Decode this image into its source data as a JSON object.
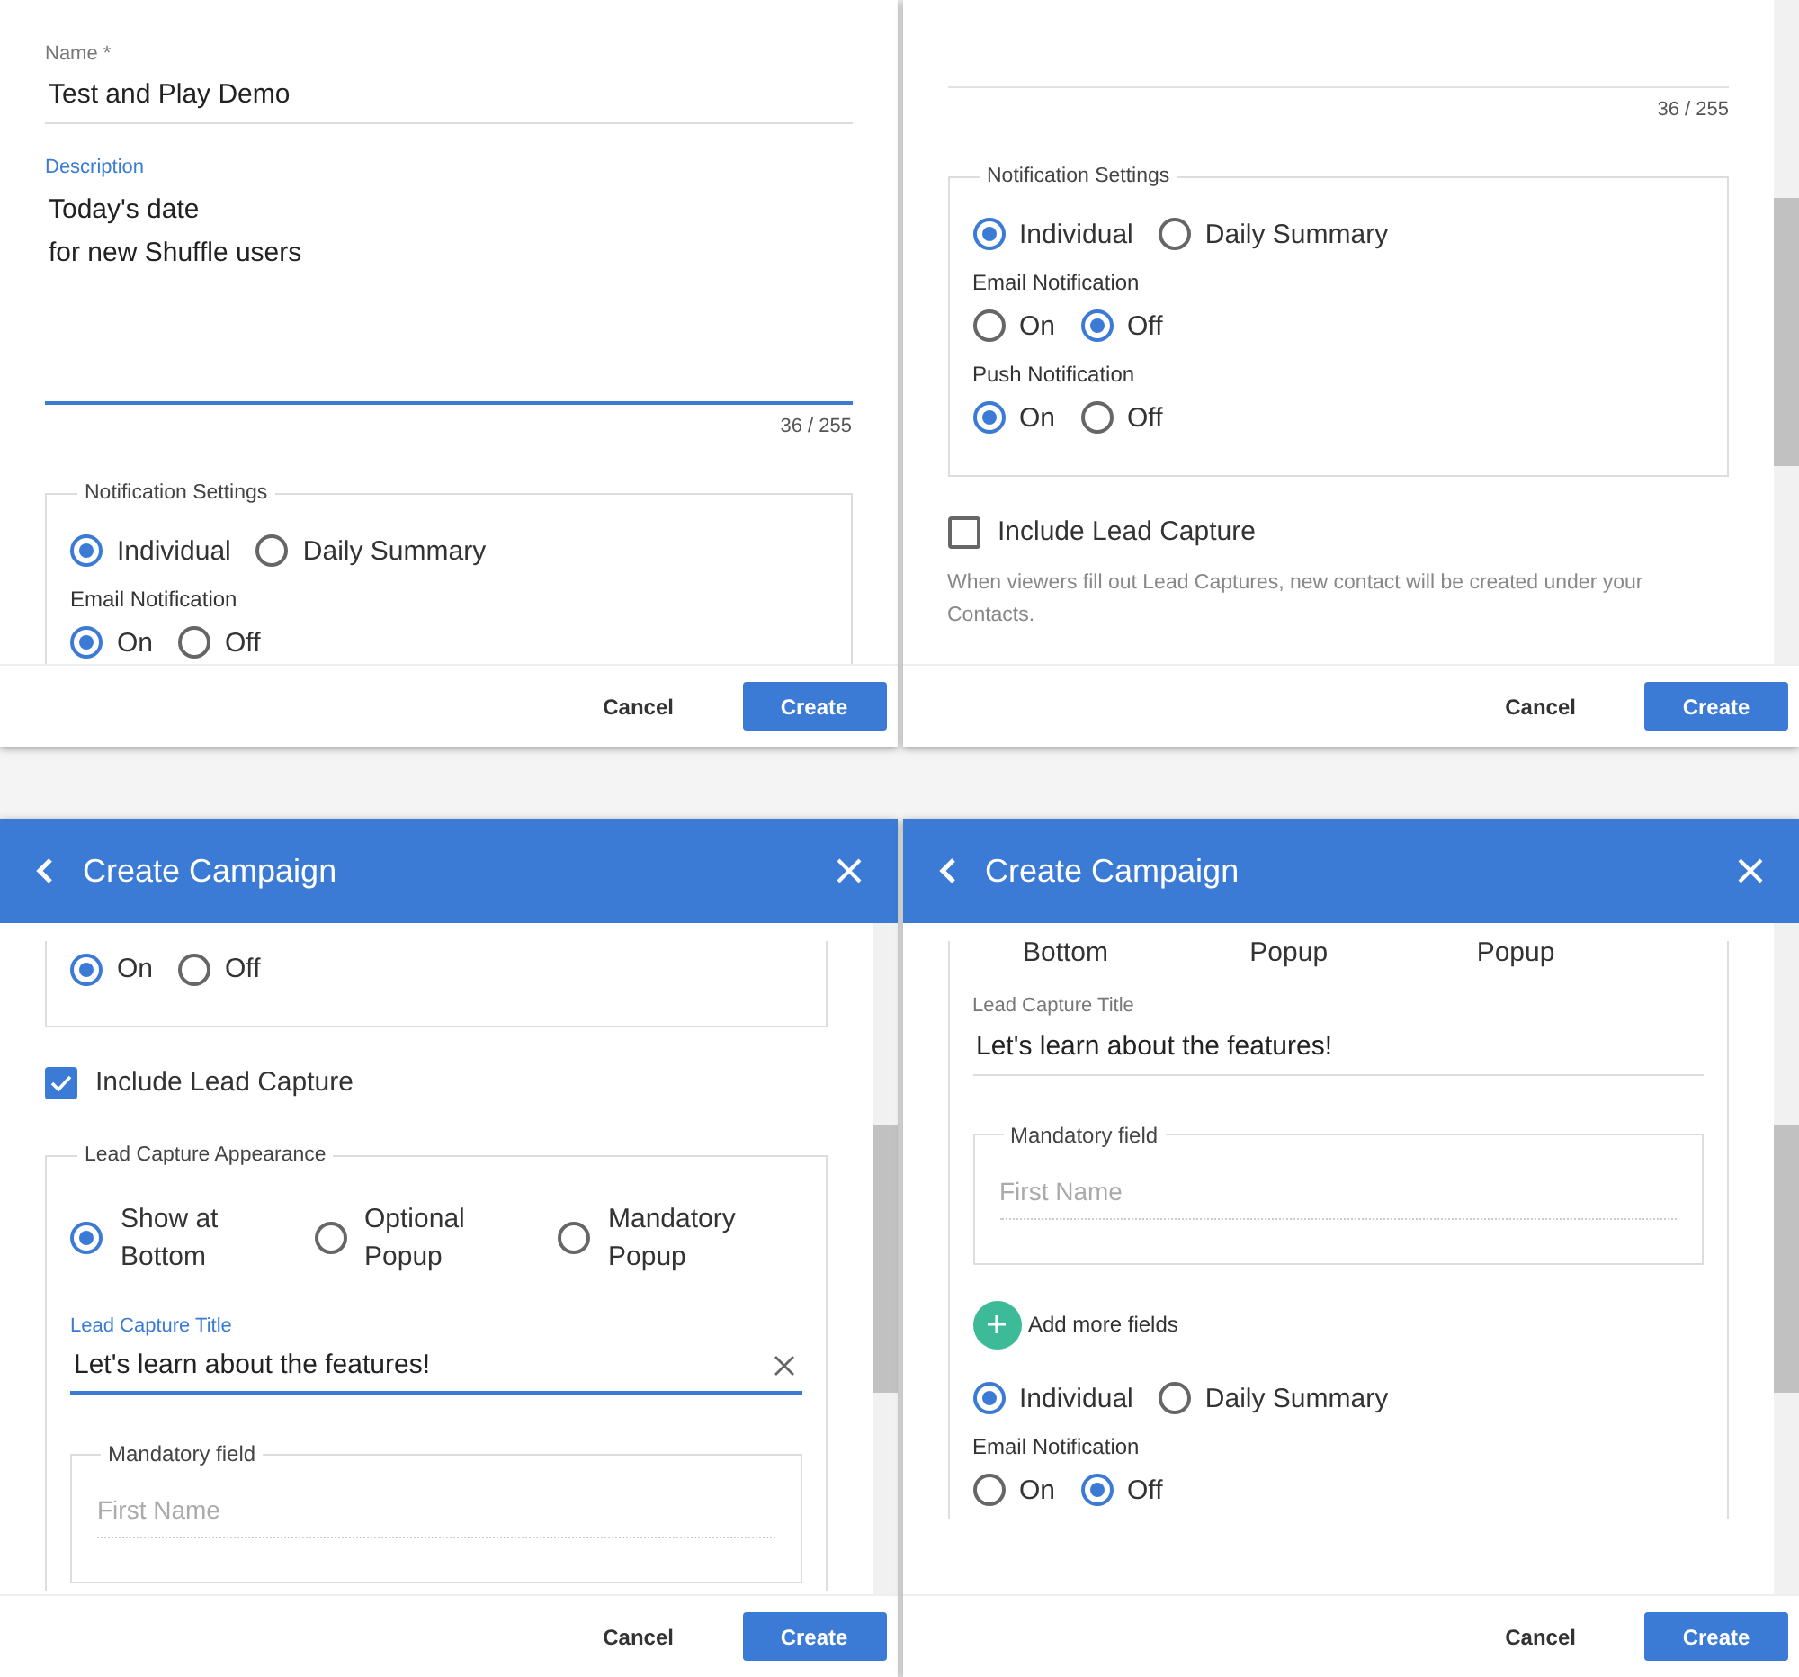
{
  "panels": [
    {
      "blocks": [
        {
          "kind": "text_field",
          "label": "Name *",
          "value": "Test and Play Demo",
          "focused": false
        },
        {
          "kind": "textarea",
          "label": "Description",
          "lines": [
            "Today's date",
            "for new Shuffle users"
          ],
          "focused": true,
          "counter": "36 / 255"
        },
        {
          "kind": "fieldset",
          "legend": "Notification Settings",
          "open_top": false,
          "open_bottom": true,
          "children": [
            {
              "kind": "radio_group",
              "options": [
                {
                  "label": "Individual",
                  "selected": true
                },
                {
                  "label": "Daily Summary",
                  "selected": false
                }
              ]
            },
            {
              "kind": "sublabel",
              "text": "Email Notification"
            },
            {
              "kind": "radio_group",
              "options": [
                {
                  "label": "On",
                  "selected": true
                },
                {
                  "label": "Off",
                  "selected": false
                }
              ]
            }
          ]
        }
      ],
      "footer": {
        "cancel": "Cancel",
        "create": "Create"
      }
    },
    {
      "scrollbar": true,
      "blocks": [
        {
          "kind": "field_end",
          "counter": "36 / 255"
        },
        {
          "kind": "fieldset",
          "legend": "Notification Settings",
          "open_top": false,
          "open_bottom": false,
          "children": [
            {
              "kind": "radio_group",
              "options": [
                {
                  "label": "Individual",
                  "selected": true
                },
                {
                  "label": "Daily Summary",
                  "selected": false
                }
              ]
            },
            {
              "kind": "sublabel",
              "text": "Email Notification"
            },
            {
              "kind": "radio_group",
              "options": [
                {
                  "label": "On",
                  "selected": false
                },
                {
                  "label": "Off",
                  "selected": true
                }
              ]
            },
            {
              "kind": "sublabel",
              "text": "Push Notification"
            },
            {
              "kind": "radio_group",
              "options": [
                {
                  "label": "On",
                  "selected": true
                },
                {
                  "label": "Off",
                  "selected": false
                }
              ]
            }
          ]
        },
        {
          "kind": "checkbox",
          "label": "Include Lead Capture",
          "checked": false
        },
        {
          "kind": "note",
          "text": "When viewers fill out Lead Captures, new contact will be created under your Contacts."
        }
      ],
      "footer": {
        "cancel": "Cancel",
        "create": "Create"
      }
    },
    {
      "header": {
        "title": "Create Campaign"
      },
      "scrollbar": true,
      "blocks": [
        {
          "kind": "fieldset",
          "open_top": true,
          "open_bottom": false,
          "children": [
            {
              "kind": "radio_group",
              "options": [
                {
                  "label": "On",
                  "selected": true
                },
                {
                  "label": "Off",
                  "selected": false
                }
              ]
            }
          ]
        },
        {
          "kind": "checkbox",
          "label": "Include Lead Capture",
          "checked": true
        },
        {
          "kind": "fieldset",
          "legend": "Lead Capture Appearance",
          "open_top": false,
          "open_bottom": true,
          "children": [
            {
              "kind": "radio_columns",
              "options": [
                {
                  "label": "Show at Bottom",
                  "selected": true
                },
                {
                  "label": "Optional Popup",
                  "selected": false
                },
                {
                  "label": "Mandatory Popup",
                  "selected": false
                }
              ]
            },
            {
              "kind": "text_field",
              "label": "Lead Capture Title",
              "value": "Let's learn about the features!",
              "focused": true,
              "clear": true
            },
            {
              "kind": "group_box",
              "legend": "Mandatory field",
              "placeholder": "First Name"
            }
          ]
        }
      ],
      "footer": {
        "cancel": "Cancel",
        "create": "Create"
      }
    },
    {
      "header": {
        "title": "Create Campaign"
      },
      "scrollbar": true,
      "blocks": [
        {
          "kind": "fieldset",
          "open_top": true,
          "open_bottom": true,
          "children": [
            {
              "kind": "cut_labels",
              "texts": [
                "Bottom",
                "Popup",
                "Popup"
              ]
            },
            {
              "kind": "text_field",
              "label": "Lead Capture Title",
              "value": "Let's learn about the features!",
              "focused": false
            },
            {
              "kind": "group_box",
              "legend": "Mandatory field",
              "placeholder": "First Name"
            },
            {
              "kind": "add_button",
              "label": "Add more fields"
            },
            {
              "kind": "radio_group",
              "options": [
                {
                  "label": "Individual",
                  "selected": true
                },
                {
                  "label": "Daily Summary",
                  "selected": false
                }
              ]
            },
            {
              "kind": "sublabel",
              "text": "Email Notification"
            },
            {
              "kind": "radio_group",
              "options": [
                {
                  "label": "On",
                  "selected": false
                },
                {
                  "label": "Off",
                  "selected": true
                }
              ]
            }
          ]
        }
      ],
      "footer": {
        "cancel": "Cancel",
        "create": "Create"
      }
    }
  ]
}
